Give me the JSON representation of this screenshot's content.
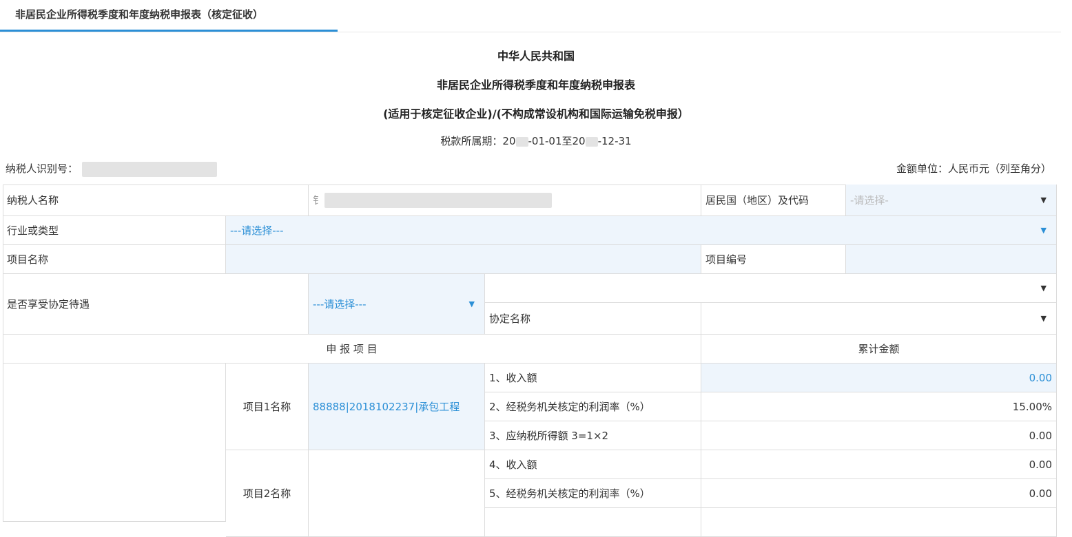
{
  "tab": {
    "title": "非居民企业所得税季度和年度纳税申报表（核定征收）"
  },
  "header": {
    "line1": "中华人民共和国",
    "line2": "非居民企业所得税季度和年度纳税申报表",
    "line3": "(适用于核定征收企业)/(不构成常设机构和国际运输免税申报）",
    "period_label": "税款所属期：",
    "period_a": "20",
    "period_b": "-01-01至20",
    "period_c": "-12-31"
  },
  "meta": {
    "taxpayer_id_label": "纳税人识别号：",
    "amount_unit": "金额单位：人民币元（列至角分）"
  },
  "form": {
    "taxpayer_name_label": "纳税人名称",
    "taxpayer_name_prefix": "钅",
    "resident_country_label": "居民国（地区）及代码",
    "resident_country_placeholder": "-请选择-",
    "industry_label": "行业或类型",
    "industry_value": "---请选择---",
    "project_name_label": "项目名称",
    "project_no_label": "项目编号",
    "agreement_label": "是否享受协定待遇",
    "agreement_value": "---请选择---",
    "agreement_name_label": "协定名称",
    "section_label": "申 报 项 目",
    "cumulative_label": "累计金额",
    "project1_label": "项目1名称",
    "project1_value": "88888|2018102237|承包工程",
    "project2_label": "项目2名称",
    "rows": [
      {
        "label": "1、收入额",
        "value": "0.00"
      },
      {
        "label": "2、经税务机关核定的利润率（%）",
        "value": "15.00%"
      },
      {
        "label": "3、应纳税所得额 3=1×2",
        "value": "0.00"
      },
      {
        "label": "4、收入额",
        "value": "0.00"
      },
      {
        "label": "5、经税务机关核定的利润率（%）",
        "value": "0.00"
      }
    ]
  },
  "icons": {
    "caret": "▼"
  }
}
